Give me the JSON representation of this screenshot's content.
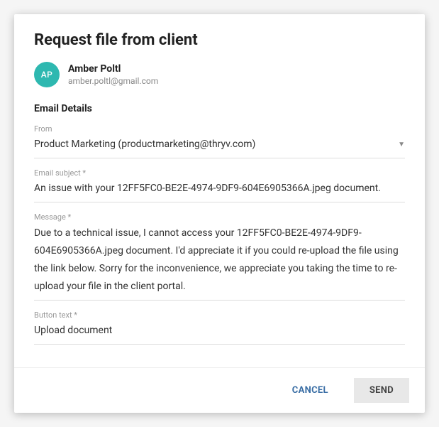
{
  "modal": {
    "title": "Request file from client"
  },
  "client": {
    "initials": "AP",
    "name": "Amber Poltl",
    "email": "amber.poltl@gmail.com"
  },
  "section": {
    "header": "Email Details"
  },
  "fields": {
    "from": {
      "label": "From",
      "value": "Product Marketing (productmarketing@thryv.com)"
    },
    "subject": {
      "label": "Email subject *",
      "value": "An issue with your 12FF5FC0-BE2E-4974-9DF9-604E6905366A.jpeg document."
    },
    "message": {
      "label": "Message *",
      "value": "Due to a technical issue, I cannot access your 12FF5FC0-BE2E-4974-9DF9-604E6905366A.jpeg document. I'd appreciate it if you could re-upload the file using the link below. Sorry for the inconvenience, we appreciate you taking the time to re-upload your file in the client portal."
    },
    "buttonText": {
      "label": "Button text *",
      "value": "Upload document"
    }
  },
  "actions": {
    "cancel": "CANCEL",
    "send": "SEND"
  }
}
